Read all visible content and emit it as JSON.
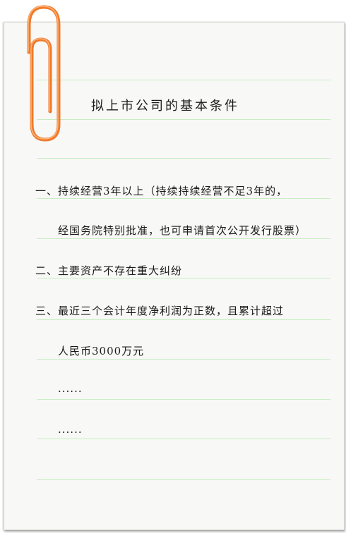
{
  "title": "拟上市公司的基本条件",
  "lines": [
    "一、持续经营3年以上（持续持续经营不足3年的，",
    "经国务院特别批准，也可申请首次公开发行股票）",
    "二、主要资产不存在重大纠纷",
    "三、最近三个会计年度净利润为正数，且累计超过",
    "人民币3000万元",
    "......",
    "......"
  ],
  "colors": {
    "clip": "#f07a2a",
    "rule": "#c8edc3",
    "paper": "#f8f8f6"
  }
}
